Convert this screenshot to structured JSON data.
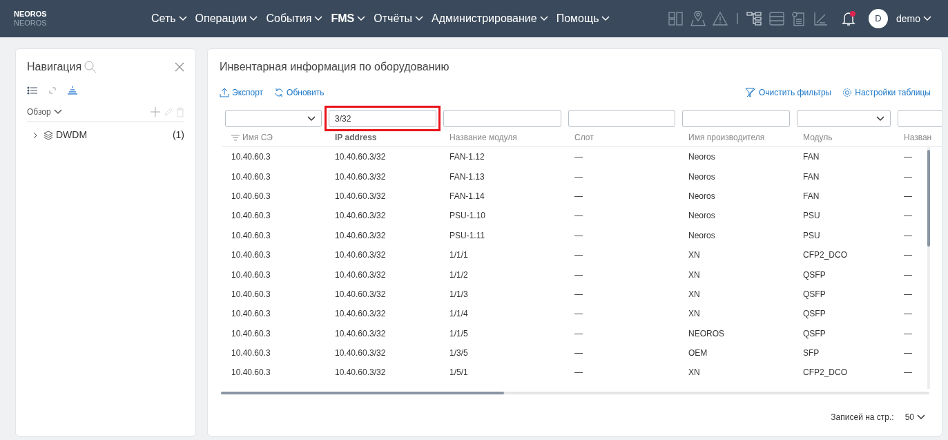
{
  "brand": {
    "name": "NEOROS",
    "subtitle": "NEOROS"
  },
  "menu": [
    {
      "label": "Сеть",
      "selected": false
    },
    {
      "label": "Операции",
      "selected": false
    },
    {
      "label": "События",
      "selected": false
    },
    {
      "label": "FMS",
      "selected": true
    },
    {
      "label": "Отчёты",
      "selected": false
    },
    {
      "label": "Администрирование",
      "selected": false
    },
    {
      "label": "Помощь",
      "selected": false
    }
  ],
  "notifications": {
    "unread": true
  },
  "user": {
    "initial": "D",
    "name": "demo"
  },
  "navigation": {
    "title": "Навигация",
    "view": "Обзор",
    "tree": [
      {
        "label": "DWDM",
        "count": "(1)",
        "expanded": false
      }
    ]
  },
  "inventory": {
    "title": "Инвентарная информация по оборудованию",
    "actions": [
      "Экспорт",
      "Обновить"
    ],
    "right_actions": [
      "Очистить фильтры",
      "Настройки таблицы"
    ],
    "filters": [
      {
        "kind": "select"
      },
      {
        "kind": "input",
        "value": "3/32",
        "highlighted": true
      },
      {
        "kind": "input",
        "highlighted": false
      },
      {
        "kind": "input",
        "highlighted": false
      },
      {
        "kind": "input",
        "highlighted": false
      },
      {
        "kind": "select"
      },
      {
        "kind": "input",
        "highlighted": false
      }
    ],
    "columns": [
      {
        "label": "Имя СЭ",
        "sorted": true
      },
      {
        "label": "IP address",
        "sorted": false
      },
      {
        "label": "Название модуля",
        "sorted": false
      },
      {
        "label": "Слот",
        "sorted": false
      },
      {
        "label": "Имя производителя",
        "sorted": false
      },
      {
        "label": "Модуль",
        "sorted": false
      },
      {
        "label": "Назван",
        "sorted": false
      }
    ],
    "rows": [
      [
        "10.40.60.3",
        "10.40.60.3/32",
        "FAN-1.12",
        "—",
        "Neoros",
        "FAN",
        "—"
      ],
      [
        "10.40.60.3",
        "10.40.60.3/32",
        "FAN-1.13",
        "—",
        "Neoros",
        "FAN",
        "—"
      ],
      [
        "10.40.60.3",
        "10.40.60.3/32",
        "FAN-1.14",
        "—",
        "Neoros",
        "FAN",
        "—"
      ],
      [
        "10.40.60.3",
        "10.40.60.3/32",
        "PSU-1.10",
        "—",
        "Neoros",
        "PSU",
        "—"
      ],
      [
        "10.40.60.3",
        "10.40.60.3/32",
        "PSU-1.11",
        "—",
        "Neoros",
        "PSU",
        "—"
      ],
      [
        "10.40.60.3",
        "10.40.60.3/32",
        "1/1/1",
        "—",
        "XN",
        "CFP2_DCO",
        "—"
      ],
      [
        "10.40.60.3",
        "10.40.60.3/32",
        "1/1/2",
        "—",
        "XN",
        "QSFP",
        "—"
      ],
      [
        "10.40.60.3",
        "10.40.60.3/32",
        "1/1/3",
        "—",
        "XN",
        "QSFP",
        "—"
      ],
      [
        "10.40.60.3",
        "10.40.60.3/32",
        "1/1/4",
        "—",
        "XN",
        "QSFP",
        "—"
      ],
      [
        "10.40.60.3",
        "10.40.60.3/32",
        "1/1/5",
        "—",
        "NEOROS",
        "QSFP",
        "—"
      ],
      [
        "10.40.60.3",
        "10.40.60.3/32",
        "1/3/5",
        "—",
        "OEM",
        "SFP",
        "—"
      ],
      [
        "10.40.60.3",
        "10.40.60.3/32",
        "1/5/1",
        "—",
        "XN",
        "CFP2_DCO",
        "—"
      ]
    ],
    "page_size_label": "Записей на стр.:",
    "page_size": "50"
  }
}
